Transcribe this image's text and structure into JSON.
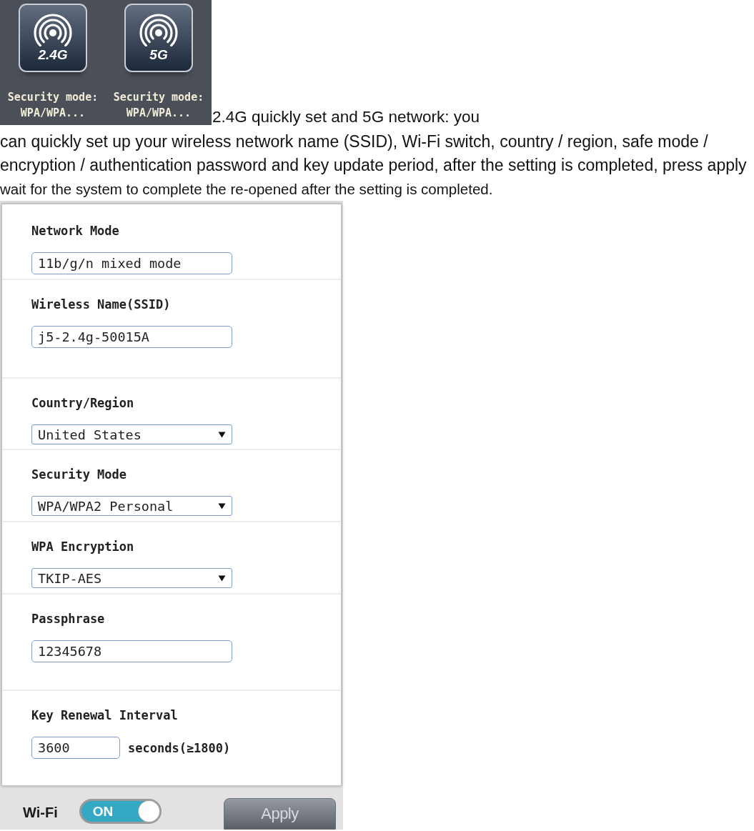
{
  "bands": [
    {
      "label": "2.4G",
      "security_label": "Security mode:",
      "security_value": "WPA/WPA..."
    },
    {
      "label": "5G",
      "security_label": "Security mode:",
      "security_value": "WPA/WPA..."
    }
  ],
  "intro": {
    "lead": "2.4G quickly set and 5G network: you",
    "body": "can quickly set up your wireless network name (SSID), Wi-Fi switch, country / region, safe mode / encryption / authentication password and key update period, after the setting is completed, press apply",
    "note": "wait for the system to complete the re-opened after the setting is completed."
  },
  "form": {
    "fields": [
      {
        "kind": "text",
        "label": "Network Mode",
        "value": "11b/g/n mixed mode"
      },
      {
        "kind": "text",
        "label": "Wireless Name(SSID)",
        "value": "j5-2.4g-50015A"
      },
      {
        "kind": "select",
        "label": "Country/Region",
        "value": "United States"
      },
      {
        "kind": "select",
        "label": "Security Mode",
        "value": "WPA/WPA2 Personal"
      },
      {
        "kind": "select",
        "label": "WPA Encryption",
        "value": "TKIP-AES"
      },
      {
        "kind": "text",
        "label": "Passphrase",
        "value": "12345678"
      },
      {
        "kind": "text",
        "label": "Key Renewal Interval",
        "value": "3600",
        "unit": "seconds(≥1800)"
      }
    ]
  },
  "footer": {
    "wifi_label": "Wi-Fi",
    "wifi_switch": {
      "on": true,
      "text": "ON"
    },
    "apply_button": "Apply"
  }
}
